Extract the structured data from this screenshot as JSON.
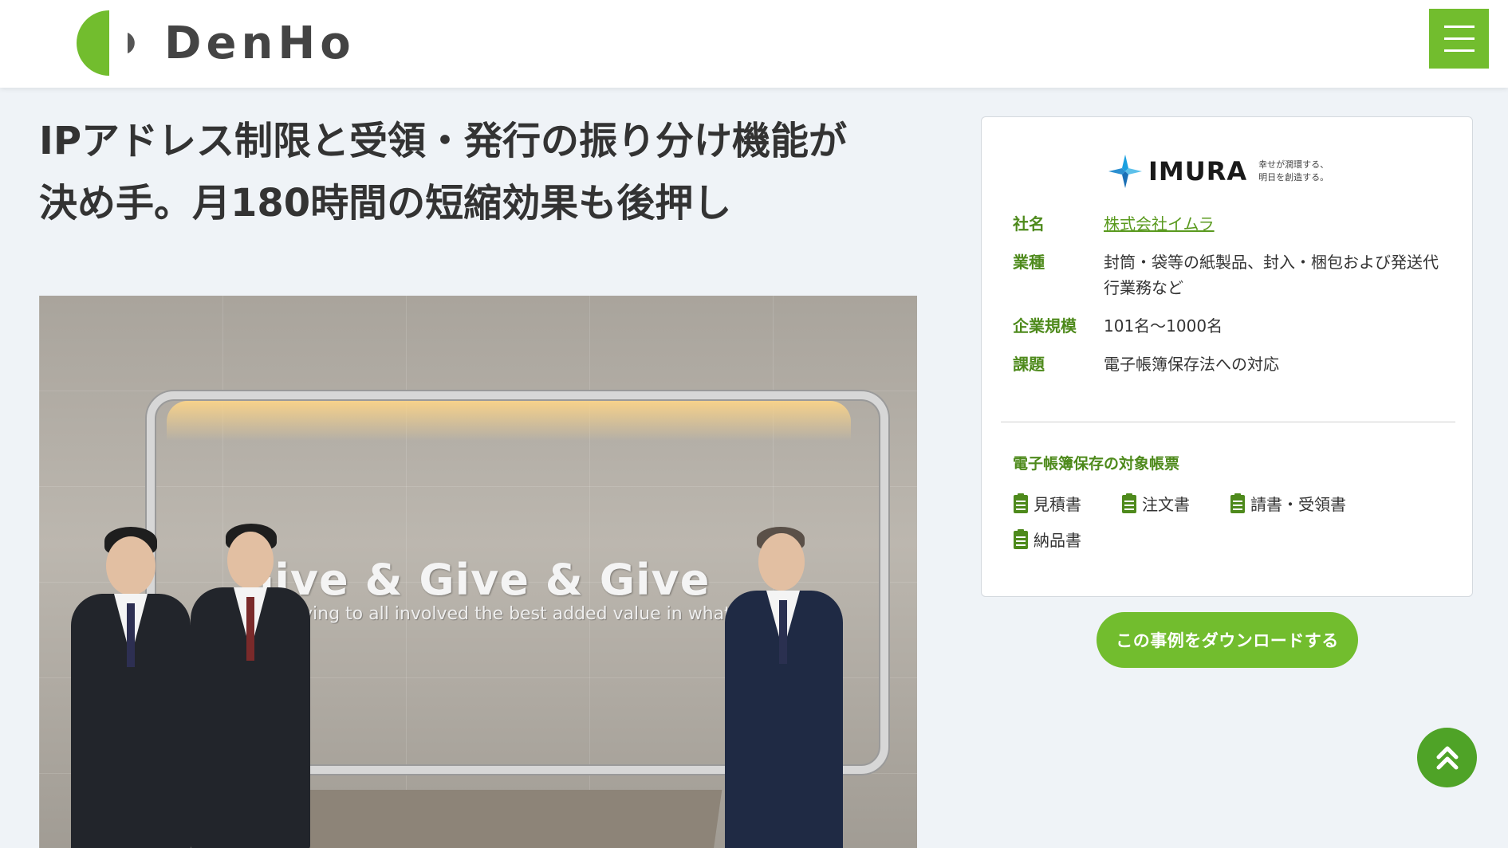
{
  "header": {
    "logo_text": "DenHo",
    "menu_icon": "hamburger-menu-icon"
  },
  "article": {
    "title_line1": "IPアドレス制限と受領・発行の振り分け機能が",
    "title_line2": "決め手。月180時間の短縮効果も後押し",
    "photo": {
      "slogan": "Give & Give & Give",
      "tagline": "ving to all involved the best added value in what we do."
    }
  },
  "company_card": {
    "logo": {
      "brand": "IMURA",
      "motto_line1": "幸せが潤環する、",
      "motto_line2": "明日を創造する。"
    },
    "rows": [
      {
        "label": "社名",
        "value": "株式会社イムラ"
      },
      {
        "label": "業種",
        "value": "封筒・袋等の紙製品、封入・梱包および発送代行業務など"
      },
      {
        "label": "企業規模",
        "value": "101名〜1000名"
      },
      {
        "label": "課題",
        "value": "電子帳簿保存法への対応"
      }
    ],
    "docs_title": "電子帳簿保存の対象帳票",
    "docs": [
      "見積書",
      "注文書",
      "請書・受領書",
      "納品書"
    ]
  },
  "download_button": "この事例をダウンロードする",
  "scroll_top_icon": "double-chevron-up-icon",
  "colors": {
    "accent": "#72bd2e",
    "label_green": "#4e8a1c",
    "page_bg": "#eff3f7",
    "to_top": "#4fa327"
  }
}
